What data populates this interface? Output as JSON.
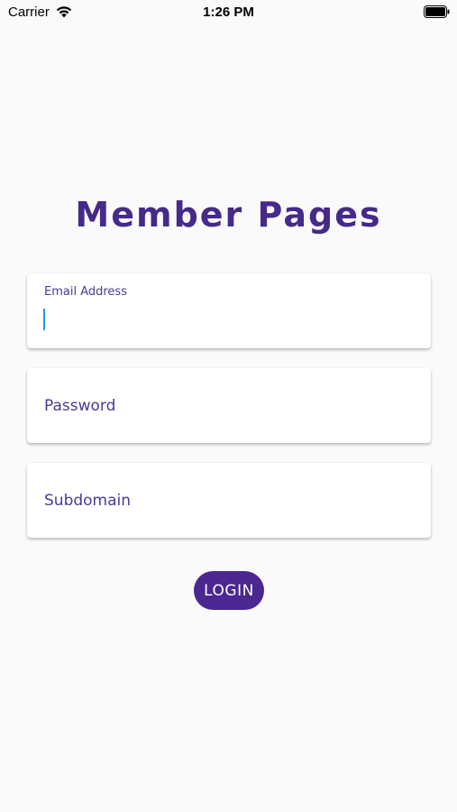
{
  "status_bar": {
    "carrier": "Carrier",
    "time": "1:26 PM",
    "wifi_icon": "wifi-icon",
    "battery_icon": "battery-full-icon"
  },
  "title": "Member Pages",
  "fields": {
    "email": {
      "label": "Email Address",
      "value": ""
    },
    "password": {
      "placeholder": "Password",
      "value": ""
    },
    "subdomain": {
      "placeholder": "Subdomain",
      "value": ""
    }
  },
  "login_button": {
    "label": "LOGIN"
  },
  "colors": {
    "brand": "#462a8a",
    "button": "#4b2791",
    "caret": "#2196f3",
    "background": "#fafafa"
  }
}
